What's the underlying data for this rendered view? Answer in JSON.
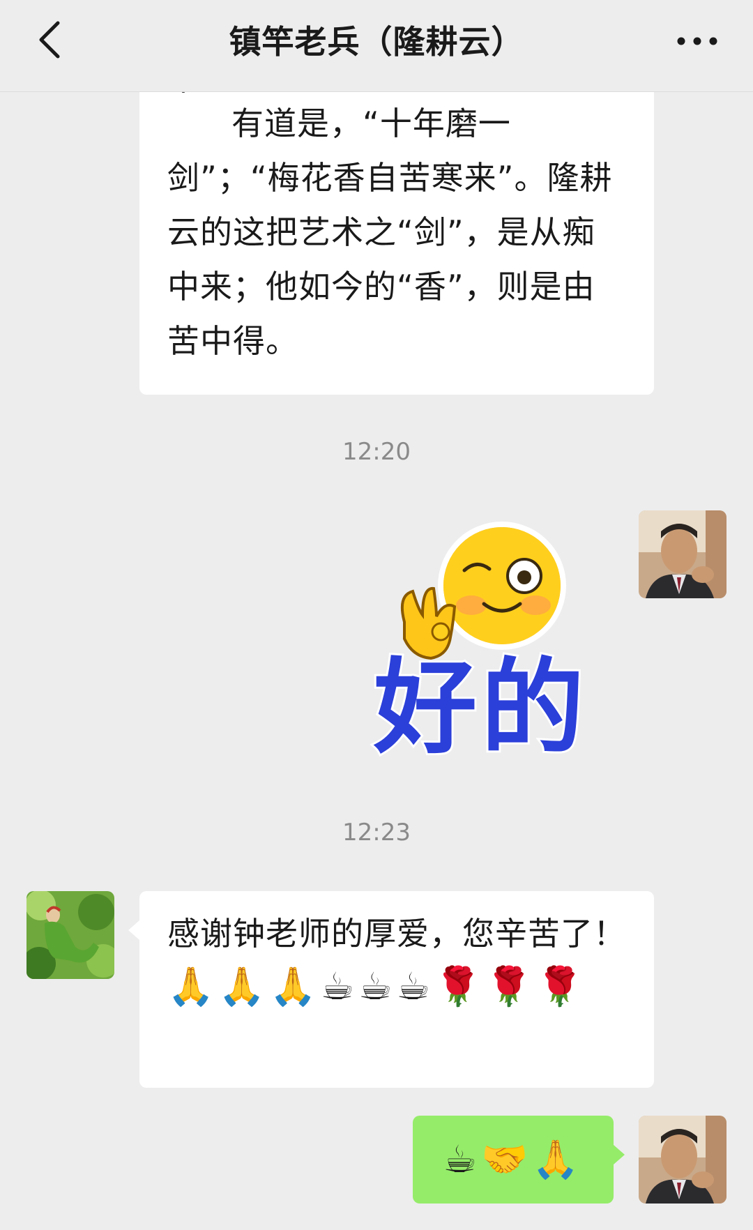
{
  "header": {
    "title": "镇竿老兵（隆耕云）",
    "back_icon": "chevron-left-icon",
    "more_icon": "more-dots-icon"
  },
  "messages": {
    "m1": {
      "partial_top": "来。",
      "text": "有道是，“十年磨一剑”；“梅花香自苦寒来”。隆耕云的这把艺术之“剑”，是从痴中来；他如今的“香”，则是由苦中得。"
    },
    "time1": "12:20",
    "sticker": {
      "text": "好的"
    },
    "time2": "12:23",
    "m2": {
      "text": "感谢钟老师的厚爱，您辛苦了！",
      "emojis": "🙏🙏🙏☕☕☕🌹🌹🌹"
    },
    "m3": {
      "emojis": "☕🤝🙏"
    }
  },
  "colors": {
    "background": "#ededed",
    "bubble_received": "#ffffff",
    "bubble_sent": "#95ec69",
    "sticker_text": "#2b3fd9"
  }
}
